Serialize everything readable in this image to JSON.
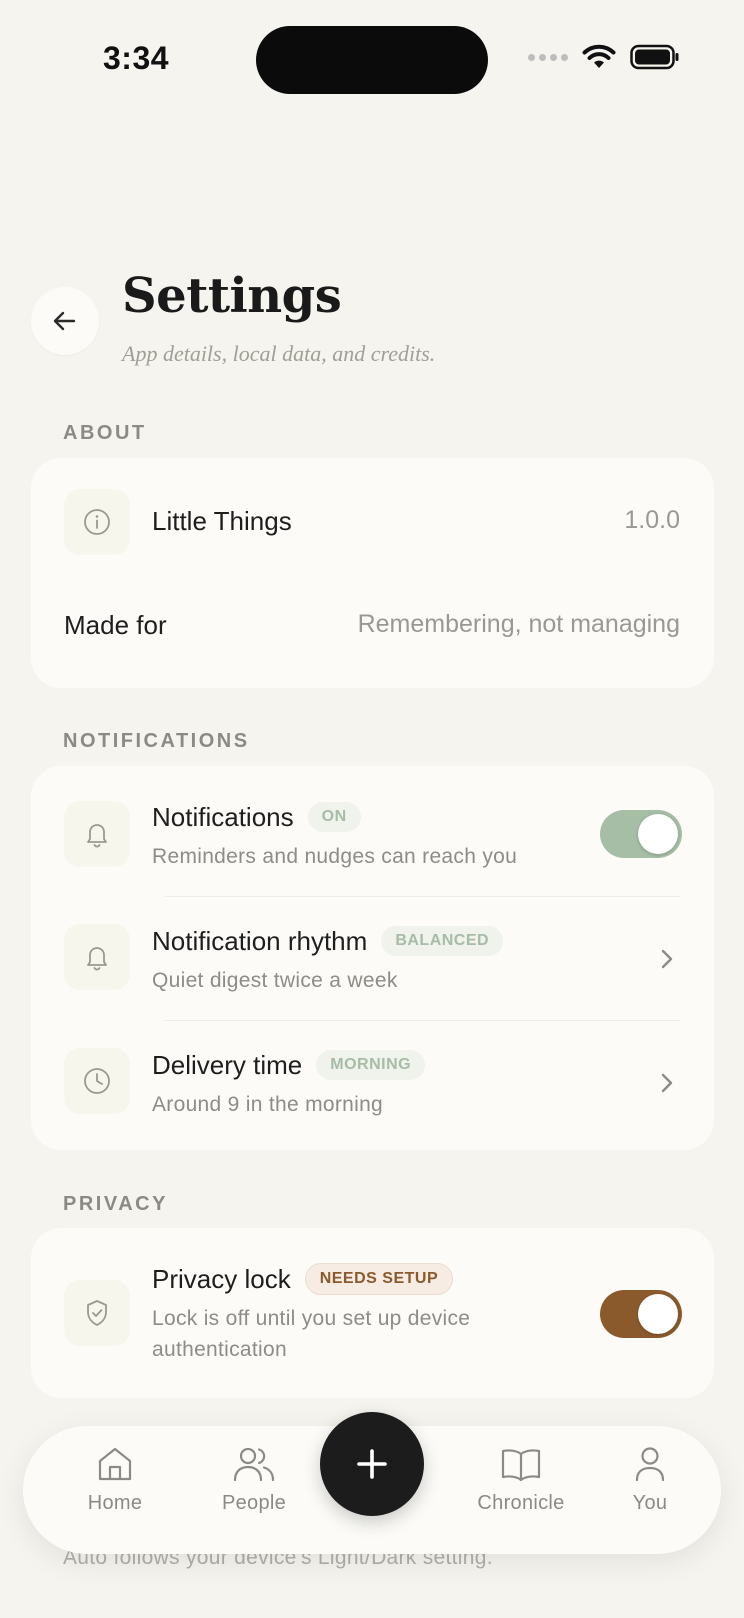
{
  "status_bar": {
    "time": "3:34"
  },
  "header": {
    "title": "Settings",
    "subtitle": "App details, local data, and credits."
  },
  "sections": {
    "about": {
      "label": "ABOUT",
      "app_name": "Little Things",
      "app_version": "1.0.0",
      "made_for_label": "Made for",
      "made_for_value": "Remembering, not managing"
    },
    "notifications": {
      "label": "NOTIFICATIONS",
      "toggle_row": {
        "title": "Notifications",
        "badge": "ON",
        "subtitle": "Reminders and nudges can reach you",
        "enabled": true
      },
      "rhythm_row": {
        "title": "Notification rhythm",
        "badge": "BALANCED",
        "subtitle": "Quiet digest twice a week"
      },
      "delivery_row": {
        "title": "Delivery time",
        "badge": "MORNING",
        "subtitle": "Around 9 in the morning"
      }
    },
    "privacy": {
      "label": "PRIVACY",
      "lock_row": {
        "title": "Privacy lock",
        "badge": "NEEDS SETUP",
        "subtitle_line1": "Lock is off until you set up device",
        "subtitle_line2": "authentication",
        "enabled": true
      }
    }
  },
  "footer_note": "Auto follows your device's Light/Dark setting.",
  "tab_bar": {
    "tabs": [
      {
        "label": "Home",
        "icon": "home-icon"
      },
      {
        "label": "People",
        "icon": "people-icon"
      },
      {
        "label": "Chronicle",
        "icon": "book-icon"
      },
      {
        "label": "You",
        "icon": "person-icon"
      }
    ],
    "add_button_icon": "plus-icon"
  },
  "colors": {
    "background": "#F5F4EF",
    "card": "#FCFBF8",
    "toggle_green": "#A6BDA6",
    "toggle_brown": "#8B5A2C",
    "fab": "#1C1C1C"
  }
}
